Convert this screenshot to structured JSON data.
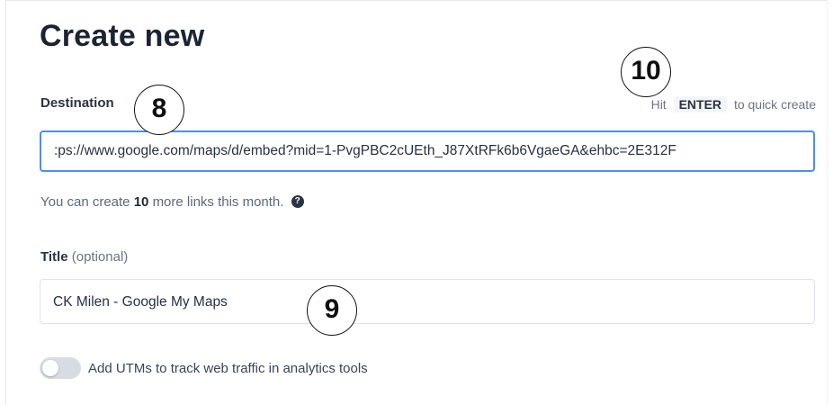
{
  "page": {
    "title": "Create new"
  },
  "destination": {
    "label": "Destination",
    "hint_prefix": "Hit",
    "hint_key": "ENTER",
    "hint_suffix": "to quick create",
    "value": ":ps://www.google.com/maps/d/embed?mid=1-PvgPBC2cUEth_J87XtRFk6b6VgaeGA&ehbc=2E312F"
  },
  "quota": {
    "prefix": "You can create",
    "count": "10",
    "suffix": "more links this month.",
    "help_icon": "question-circle-icon"
  },
  "title_field": {
    "label": "Title",
    "optional": "(optional)",
    "value": "CK Milen - Google My Maps"
  },
  "utm": {
    "label": "Add UTMs to track web traffic in analytics tools",
    "enabled": false
  },
  "callouts": {
    "a": "8",
    "b": "9",
    "c": "10"
  },
  "colors": {
    "accent": "#4d8ee8",
    "text": "#1f2a3a"
  }
}
